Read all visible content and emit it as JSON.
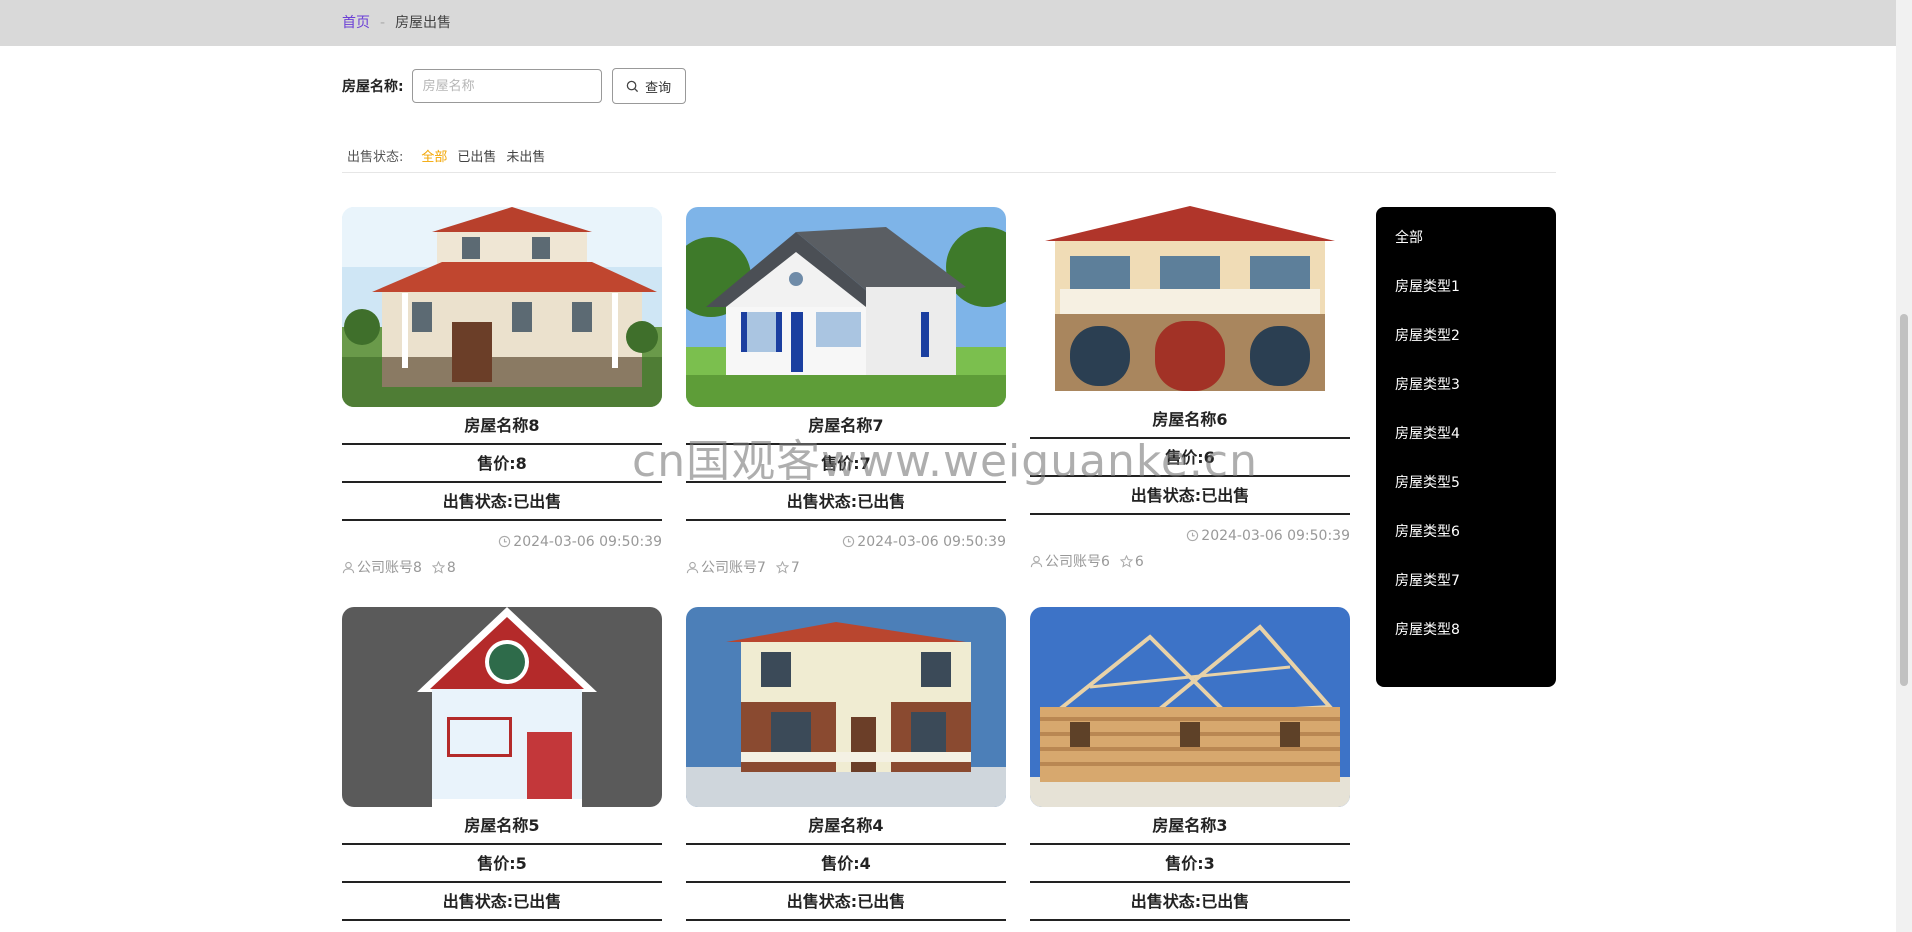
{
  "breadcrumb": {
    "home": "首页",
    "separator": "-",
    "current": "房屋出售"
  },
  "search": {
    "label": "房屋名称:",
    "placeholder": "房屋名称",
    "button": "查询"
  },
  "status_filter": {
    "label": "出售状态:",
    "options": [
      "全部",
      "已出售",
      "未出售"
    ],
    "active": "全部"
  },
  "cards": [
    {
      "name": "房屋名称8",
      "price": "售价:8",
      "status": "出售状态:已出售",
      "time": "2024-03-06 09:50:39",
      "account": "公司账号8",
      "favorites": "8"
    },
    {
      "name": "房屋名称7",
      "price": "售价:7",
      "status": "出售状态:已出售",
      "time": "2024-03-06 09:50:39",
      "account": "公司账号7",
      "favorites": "7"
    },
    {
      "name": "房屋名称6",
      "price": "售价:6",
      "status": "出售状态:已出售",
      "time": "2024-03-06 09:50:39",
      "account": "公司账号6",
      "favorites": "6"
    },
    {
      "name": "房屋名称5",
      "price": "售价:5",
      "status": "出售状态:已出售"
    },
    {
      "name": "房屋名称4",
      "price": "售价:4",
      "status": "出售状态:已出售"
    },
    {
      "name": "房屋名称3",
      "price": "售价:3",
      "status": "出售状态:已出售"
    }
  ],
  "side_menu": [
    "全部",
    "房屋类型1",
    "房屋类型2",
    "房屋类型3",
    "房屋类型4",
    "房屋类型5",
    "房屋类型6",
    "房屋类型7",
    "房屋类型8"
  ],
  "watermark": "cn国观客www.weiguanke.cn",
  "colors": {
    "active_filter": "#f2a500",
    "breadcrumb_home": "#6b3fd6",
    "side_menu_bg": "#000000"
  }
}
